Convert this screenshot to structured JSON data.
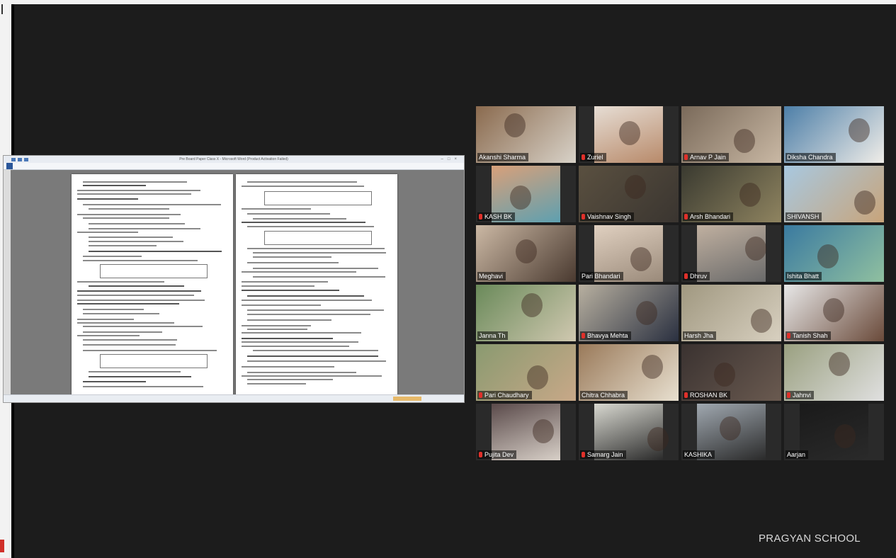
{
  "watermark": "PRAGYAN SCHOOL",
  "shared_window": {
    "title": "Pre Board Paper Class X - Microsoft Word (Product Activation Failed)"
  },
  "participants": [
    {
      "name": "Akanshi Sharma",
      "muted": false
    },
    {
      "name": "Zuriel",
      "muted": true
    },
    {
      "name": "Arnav P Jain",
      "muted": true
    },
    {
      "name": "Diksha Chandra",
      "muted": false
    },
    {
      "name": "KASH BK",
      "muted": true
    },
    {
      "name": "Vaishnav Singh",
      "muted": true
    },
    {
      "name": "Arsh Bhandari",
      "muted": true
    },
    {
      "name": "SHIVANSH",
      "muted": false
    },
    {
      "name": "Meghavi",
      "muted": false
    },
    {
      "name": "Pari Bhandari",
      "muted": false
    },
    {
      "name": "Dhruv",
      "muted": true
    },
    {
      "name": "Ishita Bhatt",
      "muted": false
    },
    {
      "name": "Janna Th",
      "muted": false
    },
    {
      "name": "Bhavya Mehta",
      "muted": true
    },
    {
      "name": "Harsh Jha",
      "muted": false
    },
    {
      "name": "Tanish Shah",
      "muted": true
    },
    {
      "name": "Pari Chaudhary",
      "muted": true
    },
    {
      "name": "Chitra Chhabra",
      "muted": false
    },
    {
      "name": "ROSHAN BK",
      "muted": true
    },
    {
      "name": "Jahnvi",
      "muted": true
    },
    {
      "name": "Pujita Dev",
      "muted": true
    },
    {
      "name": "Samarg Jain",
      "muted": true
    },
    {
      "name": "KASHIKA",
      "muted": false
    },
    {
      "name": "Aarjan",
      "muted": false
    }
  ]
}
